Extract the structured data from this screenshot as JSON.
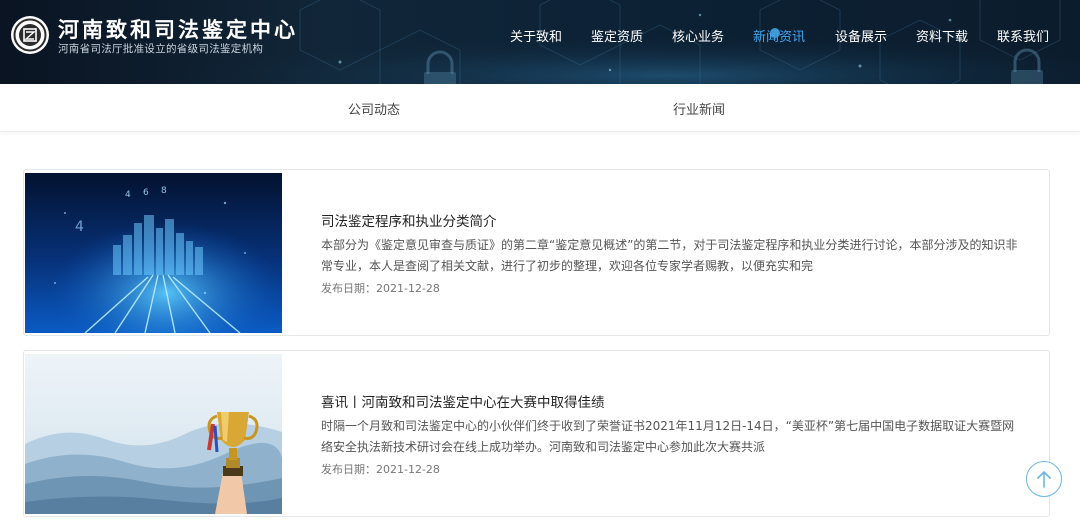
{
  "brand": {
    "title": "河南致和司法鉴定中心",
    "subtitle": "河南省司法厅批准设立的省级司法鉴定机构"
  },
  "nav": {
    "items": [
      {
        "label": "关于致和"
      },
      {
        "label": "鉴定资质"
      },
      {
        "label": "核心业务"
      },
      {
        "label": "新闻资讯",
        "active": true
      },
      {
        "label": "设备展示"
      },
      {
        "label": "资料下载"
      },
      {
        "label": "联系我们"
      }
    ]
  },
  "subnav": {
    "items": [
      {
        "label": "公司动态"
      },
      {
        "label": "行业新闻"
      }
    ]
  },
  "articles": [
    {
      "title": "司法鉴定程序和执业分类简介",
      "summary": "本部分为《鉴定意见审查与质证》的第二章“鉴定意见概述”的第二节，对于司法鉴定程序和执业分类进行讨论，本部分涉及的知识非常专业，本人是查阅了相关文献，进行了初步的整理，欢迎各位专家学者赐教，以便充实和完",
      "date": "发布日期：2021-12-28",
      "image": "city-circuit-image"
    },
    {
      "title": "喜讯丨河南致和司法鉴定中心在大赛中取得佳绩",
      "summary": "时隔一个月致和司法鉴定中心的小伙伴们终于收到了荣誉证书2021年11月12日-14日，“美亚杯”第七届中国电子数据取证大赛暨网络安全执法新技术研讨会在线上成功举办。河南致和司法鉴定中心参加此次大赛共派",
      "date": "发布日期：2021-12-28",
      "image": "trophy-mountains-image"
    }
  ],
  "colors": {
    "header_bg": "#0d2236",
    "nav_active": "#3ea6f2",
    "to_top_border": "#6ab7e4"
  },
  "icons": {
    "logo": "logo-seal-icon",
    "back_to_top": "arrow-up-icon"
  }
}
